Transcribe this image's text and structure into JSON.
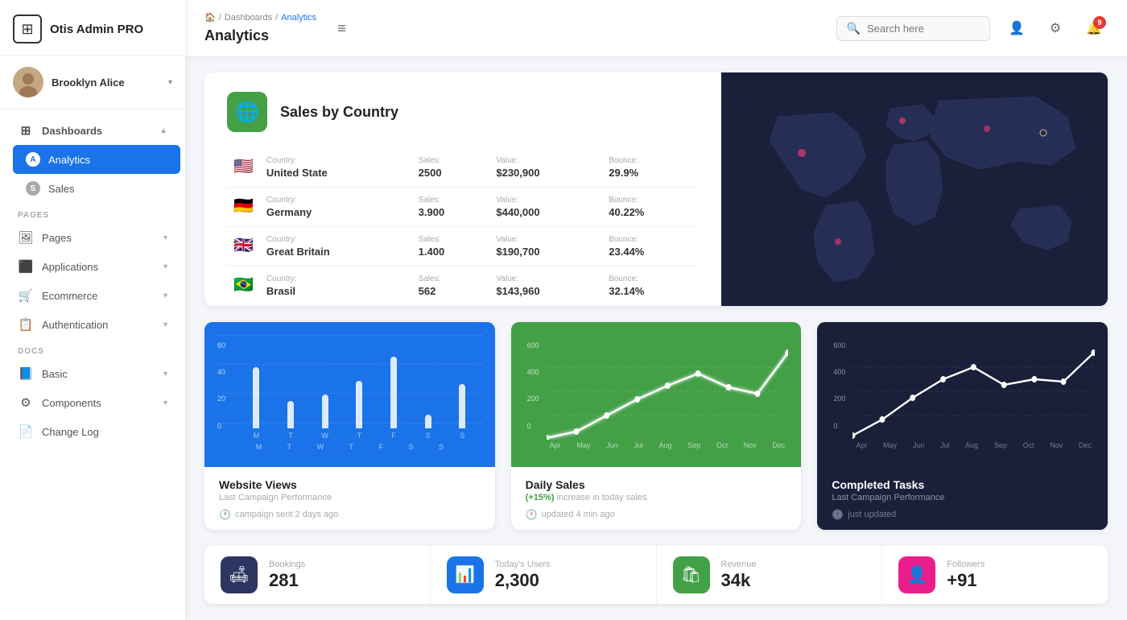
{
  "sidebar": {
    "logo": {
      "text": "Otis Admin PRO",
      "icon": "⊞"
    },
    "user": {
      "name": "Brooklyn Alice",
      "avatar_char": "🧑"
    },
    "nav": [
      {
        "id": "dashboards",
        "label": "Dashboards",
        "icon": "⊞",
        "active": false,
        "chevron": true,
        "section": null
      },
      {
        "id": "analytics",
        "label": "Analytics",
        "icon": "A",
        "active": true,
        "chevron": false,
        "section": null,
        "indent": true
      },
      {
        "id": "sales",
        "label": "Sales",
        "icon": "S",
        "active": false,
        "chevron": false,
        "section": null,
        "indent": true
      }
    ],
    "pages_section": "PAGES",
    "pages_nav": [
      {
        "id": "pages",
        "label": "Pages",
        "icon": "🖼",
        "chevron": true
      },
      {
        "id": "applications",
        "label": "Applications",
        "icon": "⬛",
        "chevron": true
      },
      {
        "id": "ecommerce",
        "label": "Ecommerce",
        "icon": "🛒",
        "chevron": true
      },
      {
        "id": "authentication",
        "label": "Authentication",
        "icon": "📋",
        "chevron": true
      }
    ],
    "docs_section": "DOCS",
    "docs_nav": [
      {
        "id": "basic",
        "label": "Basic",
        "icon": "📘",
        "chevron": true
      },
      {
        "id": "components",
        "label": "Components",
        "icon": "⚙",
        "chevron": true
      },
      {
        "id": "changelog",
        "label": "Change Log",
        "icon": "📄",
        "chevron": false
      }
    ]
  },
  "header": {
    "breadcrumb": [
      "🏠",
      "Dashboards",
      "Analytics"
    ],
    "title": "Analytics",
    "menu_icon": "≡",
    "search_placeholder": "Search here",
    "notification_count": "9"
  },
  "sales_by_country": {
    "title": "Sales by Country",
    "countries": [
      {
        "flag": "🇺🇸",
        "country_label": "Country:",
        "country": "United State",
        "sales_label": "Sales:",
        "sales": "2500",
        "value_label": "Value:",
        "value": "$230,900",
        "bounce_label": "Bounce:",
        "bounce": "29.9%"
      },
      {
        "flag": "🇩🇪",
        "country_label": "Country:",
        "country": "Germany",
        "sales_label": "Sales:",
        "sales": "3.900",
        "value_label": "Value:",
        "value": "$440,000",
        "bounce_label": "Bounce:",
        "bounce": "40.22%"
      },
      {
        "flag": "🇬🇧",
        "country_label": "Country:",
        "country": "Great Britain",
        "sales_label": "Sales:",
        "sales": "1.400",
        "value_label": "Value:",
        "value": "$190,700",
        "bounce_label": "Bounce:",
        "bounce": "23.44%"
      },
      {
        "flag": "🇧🇷",
        "country_label": "Country:",
        "country": "Brasil",
        "sales_label": "Sales:",
        "sales": "562",
        "value_label": "Value:",
        "value": "$143,960",
        "bounce_label": "Bounce:",
        "bounce": "32.14%"
      }
    ]
  },
  "website_views": {
    "title": "Website Views",
    "subtitle": "Last Campaign Performance",
    "footer": "campaign sent 2 days ago",
    "y_labels": [
      "60",
      "40",
      "20",
      "0"
    ],
    "bars": [
      {
        "label": "M",
        "height": 55
      },
      {
        "label": "T",
        "height": 25
      },
      {
        "label": "W",
        "height": 30
      },
      {
        "label": "T",
        "height": 42
      },
      {
        "label": "F",
        "height": 65
      },
      {
        "label": "S",
        "height": 12
      },
      {
        "label": "S",
        "height": 40
      }
    ]
  },
  "daily_sales": {
    "title": "Daily Sales",
    "highlight": "(+15%)",
    "subtitle": "increase in today sales.",
    "footer": "updated 4 min ago",
    "y_labels": [
      "600",
      "400",
      "200",
      "0"
    ],
    "x_labels": [
      "Apr",
      "May",
      "Jun",
      "Jul",
      "Aug",
      "Sep",
      "Oct",
      "Nov",
      "Dec"
    ],
    "points": [
      5,
      30,
      120,
      200,
      280,
      350,
      280,
      220,
      460
    ]
  },
  "completed_tasks": {
    "title": "Completed Tasks",
    "subtitle": "Last Campaign Performance",
    "footer": "just updated",
    "y_labels": [
      "600",
      "400",
      "200",
      "0"
    ],
    "x_labels": [
      "Apr",
      "May",
      "Jun",
      "Jul",
      "Aug",
      "Sep",
      "Oct",
      "Nov",
      "Dec"
    ],
    "points": [
      20,
      80,
      200,
      320,
      400,
      280,
      320,
      300,
      460
    ]
  },
  "stats": [
    {
      "id": "bookings",
      "icon": "🛋",
      "icon_class": "dark",
      "label": "Bookings",
      "value": "281"
    },
    {
      "id": "today_users",
      "icon": "📊",
      "icon_class": "blue",
      "label": "Today's Users",
      "value": "2,300"
    },
    {
      "id": "revenue",
      "icon": "🛍",
      "icon_class": "green",
      "label": "Revenue",
      "value": "34k"
    },
    {
      "id": "followers",
      "icon": "👤",
      "icon_class": "pink",
      "label": "Followers",
      "value": "+91"
    }
  ]
}
